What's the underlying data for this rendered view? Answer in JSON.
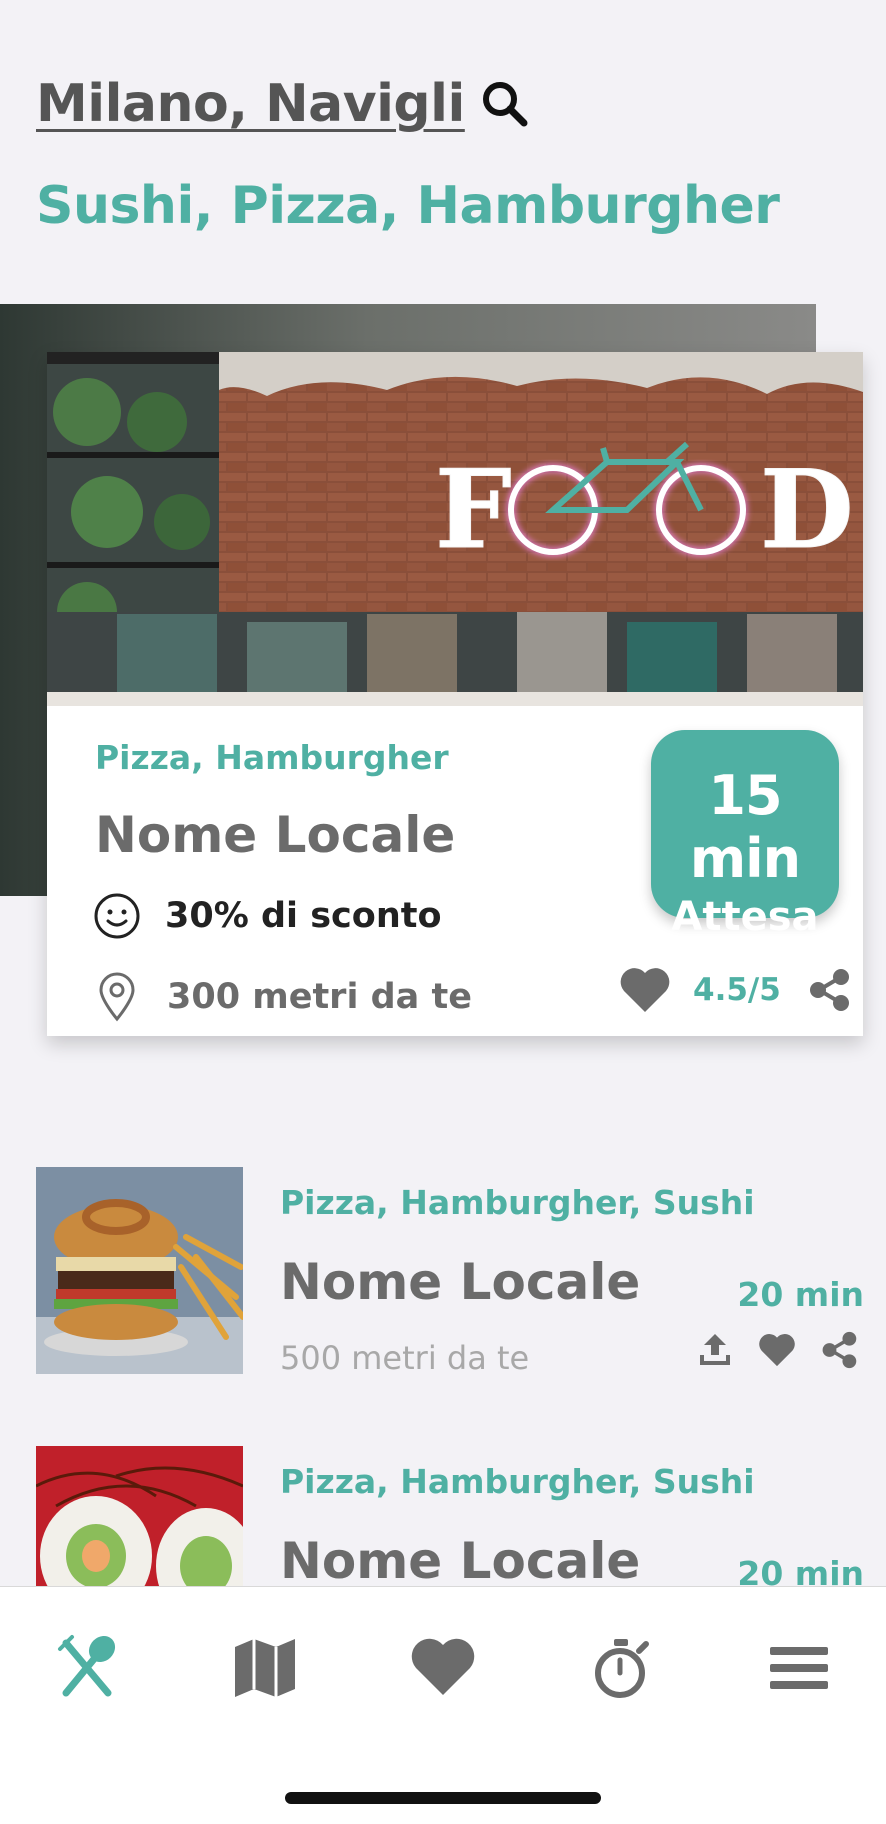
{
  "header": {
    "location": "Milano, Navigli",
    "filters": "Sushi, Pizza, Hamburgher"
  },
  "featured": {
    "tags": "Pizza, Hamburgher",
    "name": "Nome Locale",
    "discount": "30% di sconto",
    "distance": "300 metri da te",
    "wait_time": "15 min",
    "wait_label": "Attesa",
    "rating": "4.5/5",
    "image_sign_text": "FOOD"
  },
  "list": [
    {
      "tags": "Pizza, Hamburgher, Sushi",
      "name": "Nome Locale",
      "time": "20 min",
      "distance": "500 metri da te"
    },
    {
      "tags": "Pizza, Hamburgher, Sushi",
      "name": "Nome Locale",
      "time": "20 min"
    }
  ],
  "tabbar": {
    "items": [
      "restaurants-icon",
      "map-icon",
      "heart-icon",
      "timer-icon",
      "menu-icon"
    ],
    "active": "restaurants-icon"
  },
  "colors": {
    "accent": "#4fb0a3",
    "text_dark": "#555555",
    "text_gray": "#6b6b6b",
    "background": "#f3f2f6"
  }
}
